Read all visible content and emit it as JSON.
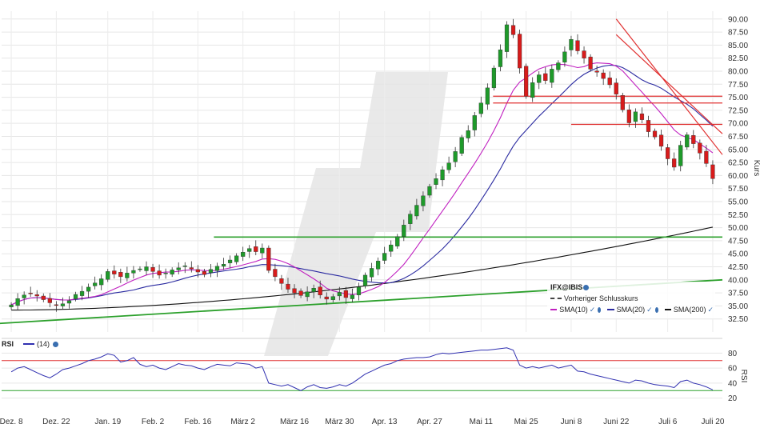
{
  "chart_data": [
    {
      "type": "candlestick",
      "title": "",
      "ylabel": "Kurs",
      "ylim": [
        30,
        91.5
      ],
      "yticks": [
        "90.00",
        "87.50",
        "85.00",
        "82.50",
        "80.00",
        "77.50",
        "75.00",
        "72.50",
        "70.00",
        "67.50",
        "65.00",
        "62.50",
        "60.00",
        "57.50",
        "55.00",
        "52.50",
        "50.00",
        "47.50",
        "45.00",
        "42.50",
        "40.00",
        "37.50",
        "35.00",
        "32.50"
      ],
      "ytick_values": [
        90,
        87.5,
        85,
        82.5,
        80,
        77.5,
        75,
        72.5,
        70,
        67.5,
        65,
        62.5,
        60,
        57.5,
        55,
        52.5,
        50,
        47.5,
        45,
        42.5,
        40,
        37.5,
        35,
        32.5
      ],
      "x_dates": [
        "Dez. 8",
        "Dez. 22",
        "Jan. 19",
        "Feb. 2",
        "Feb. 16",
        "März 2",
        "März 16",
        "März 30",
        "Apr. 13",
        "Apr. 27",
        "Mai 11",
        "Mai 25",
        "Juni 8",
        "Juni 22",
        "Juli 6",
        "Juli 20"
      ],
      "close": [
        35.2,
        36.4,
        37.1,
        37.4,
        36.9,
        36.2,
        35.6,
        35.1,
        35.4,
        36.0,
        37.2,
        37.8,
        38.6,
        39.4,
        40.2,
        41.6,
        41.1,
        40.6,
        41.3,
        41.8,
        42.1,
        42.5,
        41.6,
        40.9,
        41.3,
        41.9,
        42.3,
        42.7,
        42.1,
        41.5,
        41.0,
        42.0,
        42.6,
        43.0,
        43.8,
        44.6,
        45.3,
        46.0,
        45.4,
        46.1,
        41.8,
        40.6,
        39.3,
        38.2,
        37.5,
        37.0,
        37.7,
        38.4,
        37.1,
        36.3,
        36.8,
        37.6,
        36.6,
        37.1,
        38.6,
        40.9,
        42.2,
        43.6,
        45.1,
        46.7,
        48.3,
        50.5,
        52.6,
        54.3,
        56.1,
        57.9,
        59.4,
        61.1,
        62.4,
        64.6,
        67.3,
        68.6,
        71.5,
        73.9,
        76.8,
        80.6,
        84.1,
        88.9,
        87.0,
        80.6,
        75.2,
        77.8,
        79.3,
        78.2,
        80.4,
        81.6,
        83.7,
        86.1,
        83.9,
        82.5,
        80.4,
        79.8,
        78.6,
        77.4,
        75.6,
        72.6,
        70.1,
        72.2,
        70.7,
        68.4,
        67.4,
        65.6,
        63.2,
        61.6,
        65.8,
        67.8,
        66.1,
        64.3,
        62.3,
        59.4
      ],
      "series": [
        {
          "name": "SMA(10)",
          "color": "#c020c0"
        },
        {
          "name": "SMA(20)",
          "color": "#2a2aa0"
        },
        {
          "name": "SMA(200)",
          "color": "#111111"
        }
      ],
      "sma200_start": 34.2,
      "sma200_end": 50.1,
      "horizontal_lines": [
        {
          "value": 48.2,
          "color": "#2ca02c"
        },
        {
          "value": 75.2,
          "color": "#e03030"
        },
        {
          "value": 73.9,
          "color": "#e03030"
        },
        {
          "value": 69.8,
          "color": "#e03030"
        }
      ],
      "trendlines": [
        {
          "color": "#2ca02c",
          "from": {
            "date": "Dez. 8",
            "value": 31.5
          },
          "to": {
            "date": "Juli 20",
            "value": 40.0
          }
        },
        {
          "color": "#e03030",
          "from": {
            "date": "Juni 22",
            "value": 90.0
          },
          "to": {
            "date": "Juli 20",
            "value": 64.0
          }
        },
        {
          "color": "#e03030",
          "from": {
            "date": "Juni 22",
            "value": 87.0
          },
          "to": {
            "date": "Juli 20",
            "value": 68.0
          }
        }
      ],
      "up_color": "#1e9a2a",
      "down_color": "#d81b1b",
      "legend": {
        "symbol": "IFX@IBIS",
        "prev_close": "Vorheriger Schlusskurs",
        "sma10": "SMA(10)",
        "sma20": "SMA(20)",
        "sma200": "SMA(200)",
        "placement": "bottom-right"
      }
    },
    {
      "type": "line",
      "title": "",
      "ylabel": "RSI",
      "series_label": "(14)",
      "panel_label": "RSI",
      "ylim": [
        10,
        90
      ],
      "yticks": [
        "80",
        "60",
        "40",
        "20"
      ],
      "ytick_values": [
        80,
        60,
        40,
        20
      ],
      "overbought": 70,
      "oversold": 30,
      "series": [
        {
          "name": "RSI (14)",
          "color": "#3030b0",
          "values": [
            55,
            60,
            62,
            58,
            54,
            50,
            47,
            52,
            58,
            60,
            63,
            66,
            70,
            72,
            75,
            79,
            77,
            68,
            70,
            74,
            65,
            62,
            64,
            60,
            58,
            62,
            66,
            64,
            63,
            60,
            58,
            62,
            65,
            64,
            63,
            67,
            66,
            65,
            60,
            62,
            40,
            38,
            36,
            38,
            34,
            30,
            35,
            38,
            34,
            33,
            35,
            38,
            36,
            40,
            46,
            52,
            56,
            60,
            64,
            66,
            70,
            72,
            73,
            74,
            74,
            75,
            78,
            80,
            79,
            80,
            81,
            82,
            83,
            84,
            84,
            85,
            86,
            87,
            84,
            64,
            60,
            62,
            60,
            62,
            64,
            60,
            62,
            64,
            56,
            55,
            52,
            50,
            48,
            46,
            44,
            42,
            40,
            44,
            43,
            40,
            38,
            37,
            36,
            34,
            42,
            44,
            40,
            38,
            35,
            31
          ]
        }
      ]
    }
  ],
  "x_axis_labels": [
    "Dez. 8",
    "Dez. 22",
    "Jan. 19",
    "Feb. 2",
    "Feb. 16",
    "März 2",
    "März 16",
    "März 30",
    "Apr. 13",
    "Apr. 27",
    "Mai 11",
    "Mai 25",
    "Juni 8",
    "Juni 22",
    "Juli 6",
    "Juli 20"
  ]
}
